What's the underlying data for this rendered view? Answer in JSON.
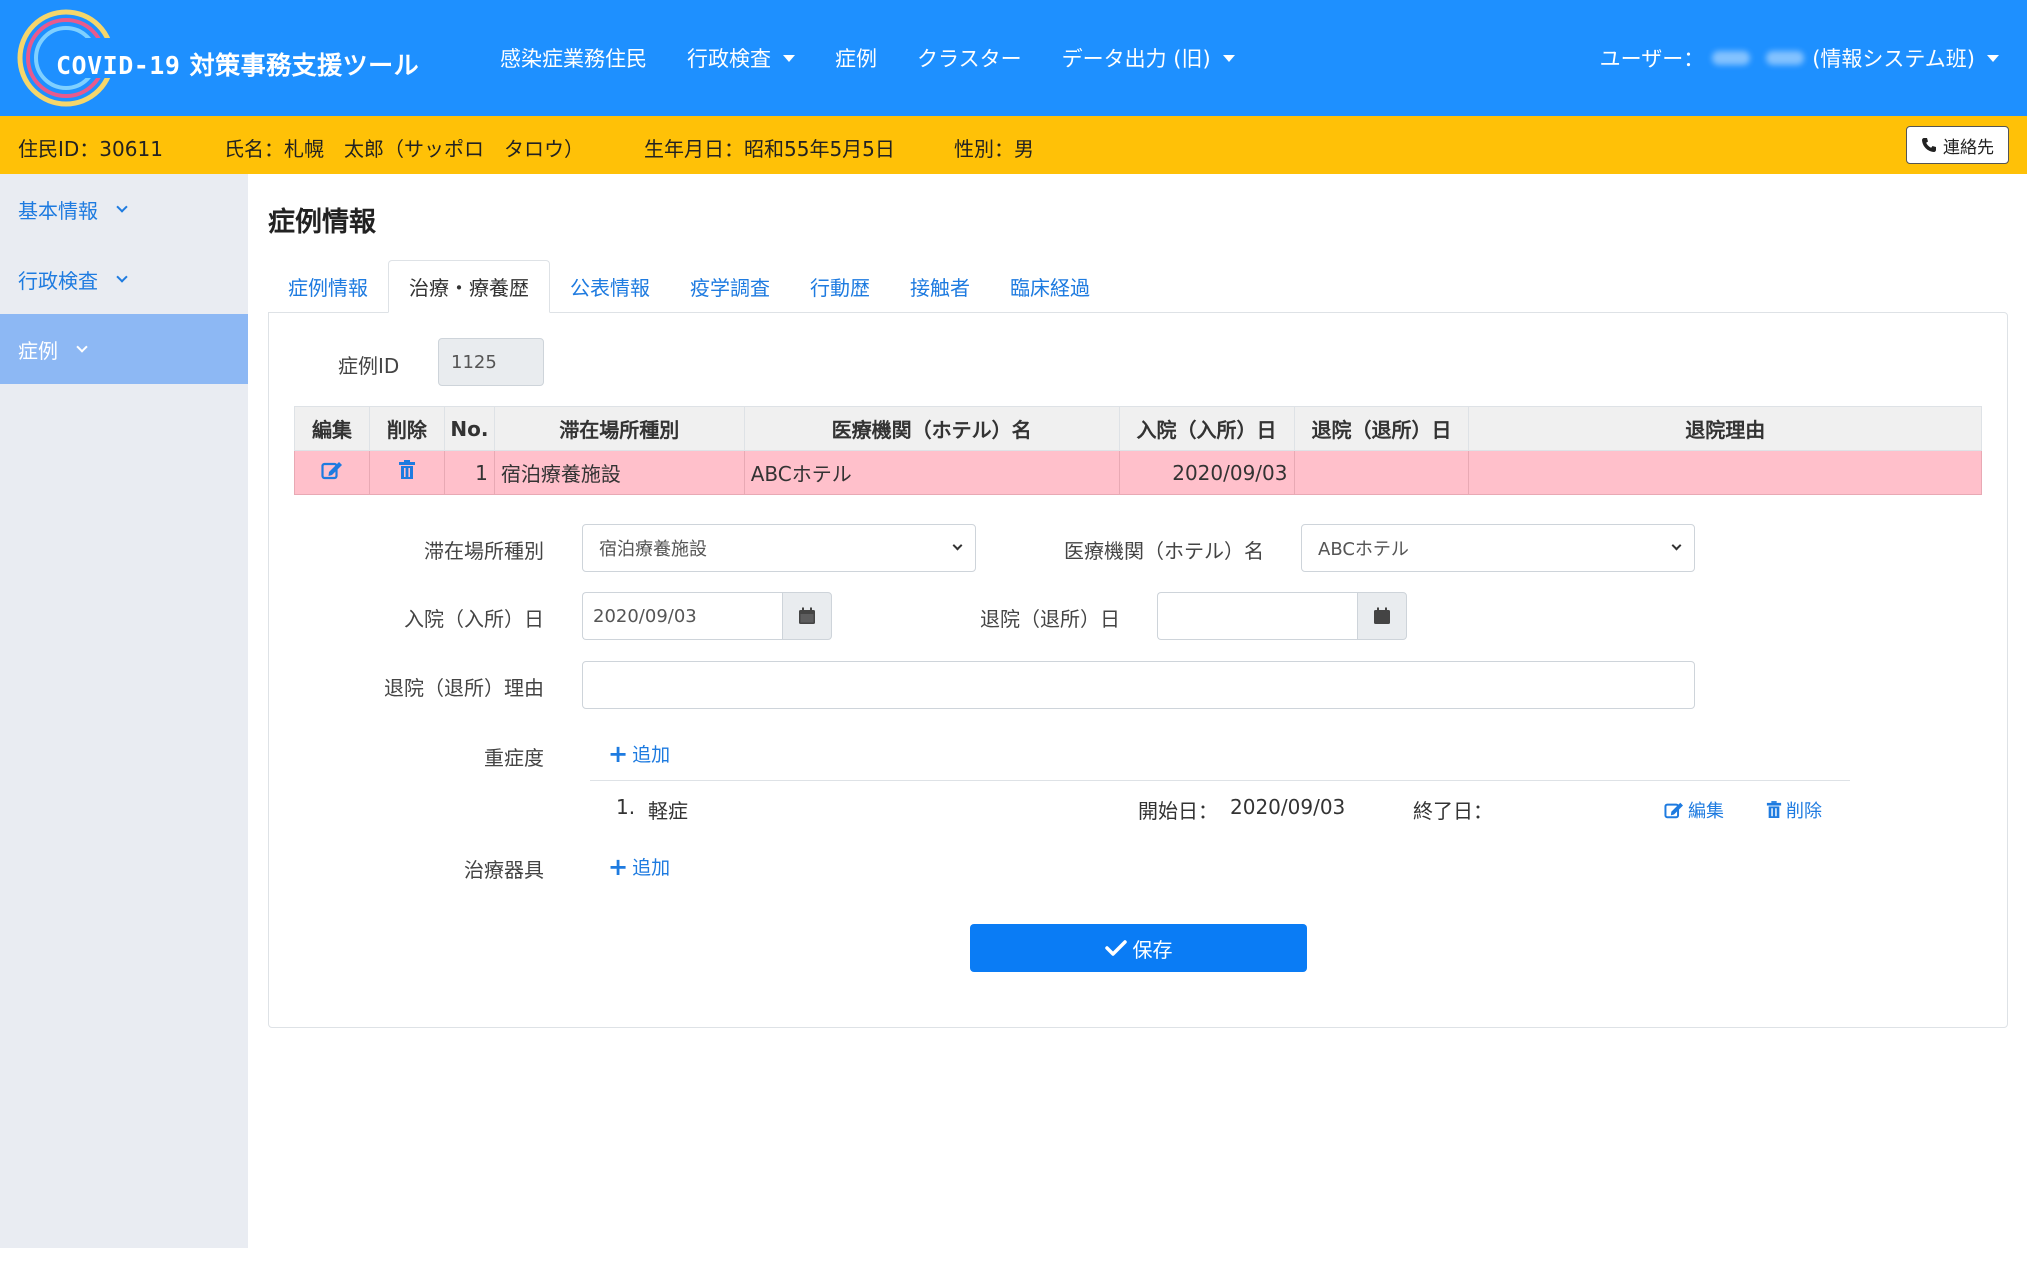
{
  "header": {
    "brand_prefix": "COVID-19",
    "brand_suffix": " 対策事務支援ツール",
    "nav": [
      {
        "label": "感染症業務住民",
        "dropdown": false
      },
      {
        "label": "行政検査",
        "dropdown": true
      },
      {
        "label": "症例",
        "dropdown": false
      },
      {
        "label": "クラスター",
        "dropdown": false
      },
      {
        "label": "データ出力 (旧)",
        "dropdown": true
      }
    ],
    "user_label": "ユーザー：",
    "user_org": "(情報システム班)",
    "accent_color": "#1e90ff"
  },
  "resident": {
    "id": "住民ID：30611",
    "name": "氏名：札幌　太郎（サッポロ　タロウ）",
    "birth": "生年月日：昭和55年5月5日",
    "sex": "性別：男",
    "contact_button": "連絡先",
    "bar_color": "#ffc107"
  },
  "sidebar": {
    "items": [
      {
        "label": "基本情報",
        "active": false
      },
      {
        "label": "行政検査",
        "active": false
      },
      {
        "label": "症例",
        "active": true
      }
    ]
  },
  "main": {
    "title": "症例情報",
    "tabs": [
      {
        "label": "症例情報",
        "active": false
      },
      {
        "label": "治療・療養歴",
        "active": true
      },
      {
        "label": "公表情報",
        "active": false
      },
      {
        "label": "疫学調査",
        "active": false
      },
      {
        "label": "行動歴",
        "active": false
      },
      {
        "label": "接触者",
        "active": false
      },
      {
        "label": "臨床経過",
        "active": false
      }
    ],
    "case_id_label": "症例ID",
    "case_id_value": "1125",
    "table": {
      "headers": [
        "編集",
        "削除",
        "No.",
        "滞在場所種別",
        "医療機関（ホテル）名",
        "入院（入所）日",
        "退院（退所）日",
        "退院理由"
      ],
      "rows": [
        {
          "no": "1",
          "stay_type": "宿泊療養施設",
          "facility": "ABCホテル",
          "admit_date": "2020/09/03",
          "discharge_date": "",
          "reason": ""
        }
      ]
    },
    "form": {
      "stay_type_label": "滞在場所種別",
      "stay_type_value": "宿泊療養施設",
      "facility_label": "医療機関（ホテル）名",
      "facility_value": "ABCホテル",
      "admit_label": "入院（入所）日",
      "admit_value": "2020/09/03",
      "discharge_label": "退院（退所）日",
      "discharge_value": "",
      "reason_label": "退院（退所）理由",
      "reason_value": "",
      "severity_label": "重症度",
      "add_label": "追加",
      "severity_item": {
        "index": "1.",
        "name": "軽症",
        "start_label": "開始日：",
        "start_value": "2020/09/03",
        "end_label": "終了日：",
        "edit_label": "編集",
        "delete_label": "削除"
      },
      "device_label": "治療器具",
      "save_label": "保存"
    }
  }
}
